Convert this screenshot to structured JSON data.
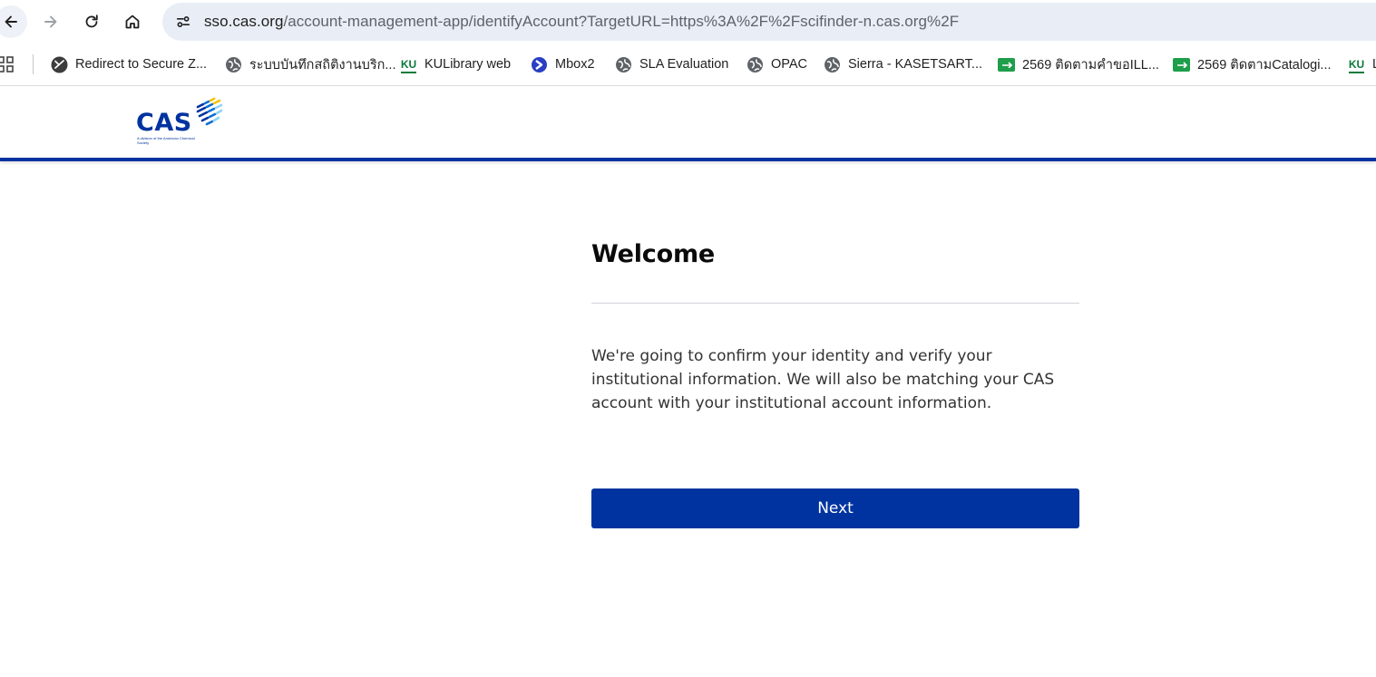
{
  "browser": {
    "url": {
      "host": "sso.cas.org",
      "path": "/account-management-app/identifyAccount?TargetURL=https%3A%2F%2Fscifinder-n.cas.org%2F"
    },
    "icons": {
      "back": "arrow-left-icon",
      "forward": "arrow-right-icon",
      "reload": "reload-icon",
      "home": "home-icon",
      "site_info": "tune-icon"
    },
    "bookmarks": [
      {
        "label": "Redirect to Secure Z...",
        "icon": "zscaler-icon"
      },
      {
        "label": "ระบบบันทึกสถิติงานบริก...",
        "icon": "globe-icon"
      },
      {
        "label": "KULibrary web",
        "icon": "ku-logo-icon"
      },
      {
        "label": "Mbox2",
        "icon": "mbox-icon"
      },
      {
        "label": "SLA Evaluation",
        "icon": "globe-icon"
      },
      {
        "label": "OPAC",
        "icon": "globe-icon"
      },
      {
        "label": "Sierra - KASETSART...",
        "icon": "globe-icon"
      },
      {
        "label": "2569 ติดตามคำขอILL...",
        "icon": "sheets-icon"
      },
      {
        "label": "2569 ติดตามCatalogi...",
        "icon": "sheets-icon"
      },
      {
        "label": "L",
        "icon": "ku-logo-icon"
      }
    ]
  },
  "header": {
    "logo_text": "CAS",
    "logo_subtext": "A division of the American Chemical Society",
    "brand_color": "#0033a0"
  },
  "main": {
    "title": "Welcome",
    "description": "We're going to confirm your identity and verify your institutional information. We will also be matching your CAS account with your institutional account information.",
    "next_button_label": "Next"
  }
}
